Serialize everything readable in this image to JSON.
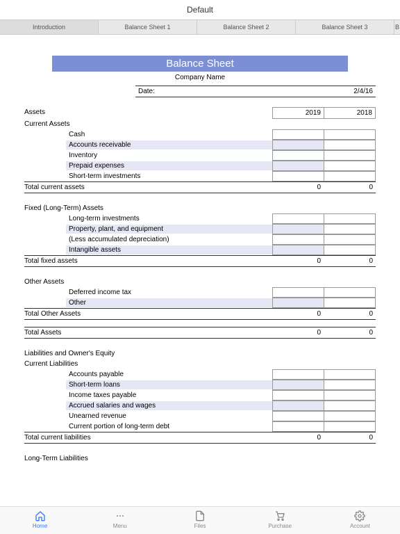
{
  "topTitle": "Default",
  "tabs": [
    "Introduction",
    "Balance Sheet 1",
    "Balance Sheet 2",
    "Balance Sheet 3",
    "B"
  ],
  "banner": "Balance Sheet",
  "company": "Company Name",
  "dateLabel": "Date:",
  "dateValue": "2/4/16",
  "year1": "2019",
  "year2": "2018",
  "assets": "Assets",
  "currentAssets": "Current Assets",
  "ca": {
    "cash": "Cash",
    "ar": "Accounts receivable",
    "inv": "Inventory",
    "pre": "Prepaid expenses",
    "sti": "Short-term investments"
  },
  "totCA": "Total current assets",
  "fixedAssets": "Fixed (Long-Term) Assets",
  "fa": {
    "lti": "Long-term investments",
    "ppe": "Property, plant, and equipment",
    "dep": "(Less accumulated depreciation)",
    "int": "Intangible assets"
  },
  "totFA": "Total fixed assets",
  "otherAssets": "Other Assets",
  "oa": {
    "dit": "Deferred income tax",
    "oth": "Other"
  },
  "totOA": "Total Other Assets",
  "totA": "Total Assets",
  "liab": "Liabilities and Owner's Equity",
  "curLiab": "Current Liabilities",
  "cl": {
    "ap": "Accounts payable",
    "stl": "Short-term loans",
    "itp": "Income taxes payable",
    "asw": "Accrued salaries and wages",
    "ur": "Unearned revenue",
    "cpd": "Current portion of long-term debt"
  },
  "totCL": "Total current liabilities",
  "ltLiab": "Long-Term Liabilities",
  "zero": "0",
  "nav": {
    "home": "Home",
    "menu": "Menu",
    "files": "Files",
    "purchase": "Purchase",
    "account": "Account"
  }
}
